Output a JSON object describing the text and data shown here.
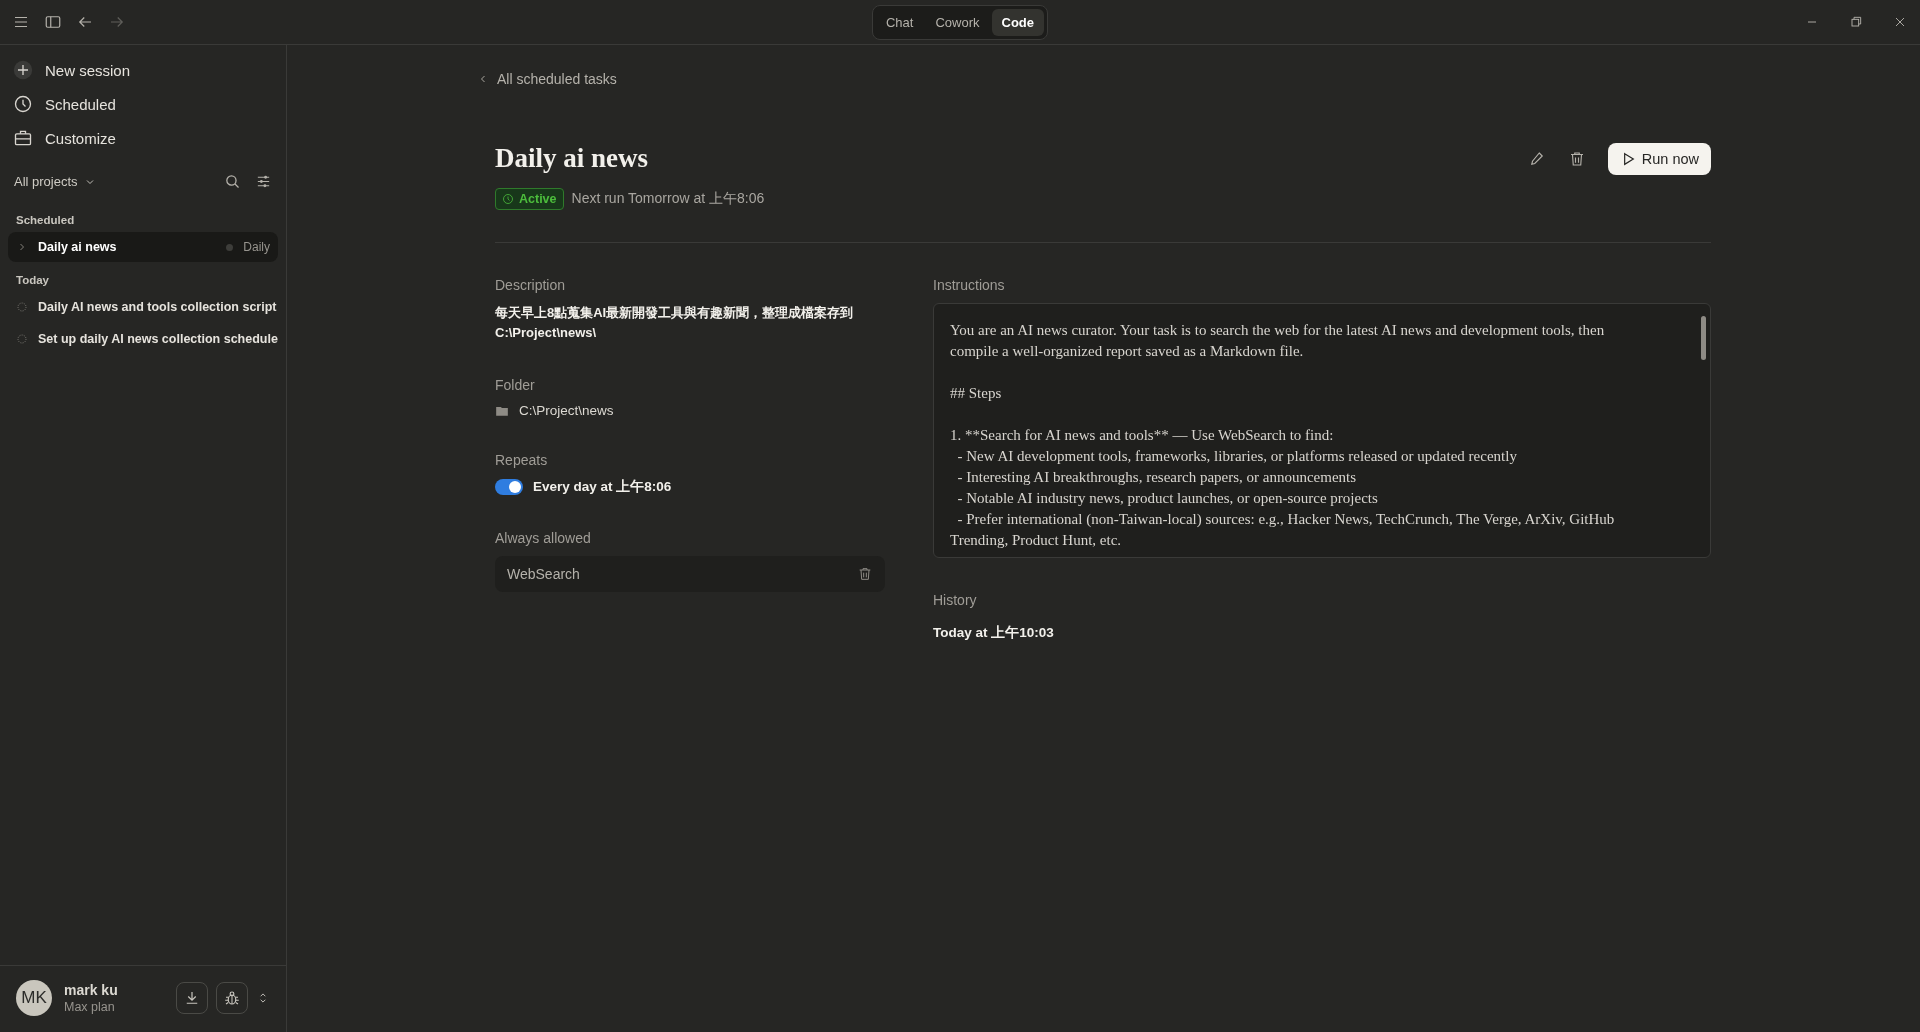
{
  "titlebar": {
    "nav": [
      {
        "kind": "menu",
        "disabled": false
      },
      {
        "kind": "sidebar",
        "disabled": false
      },
      {
        "kind": "back",
        "disabled": false
      },
      {
        "kind": "forward",
        "disabled": true
      }
    ],
    "modes": [
      {
        "label": "Chat",
        "selected": false
      },
      {
        "label": "Cowork",
        "selected": false
      },
      {
        "label": "Code",
        "selected": true
      }
    ],
    "window_controls": [
      {
        "kind": "minimize"
      },
      {
        "kind": "restore"
      },
      {
        "kind": "close"
      }
    ]
  },
  "sidebar": {
    "actions": [
      {
        "kind": "plus",
        "label": "New session"
      },
      {
        "kind": "clock",
        "label": "Scheduled"
      },
      {
        "kind": "briefcase",
        "label": "Customize"
      }
    ],
    "project_filter": "All projects",
    "sections": [
      {
        "title": "Scheduled",
        "items": [
          {
            "kind": "scheduled",
            "label": "Daily ai news",
            "badge": "Daily",
            "selected": true
          }
        ]
      },
      {
        "title": "Today",
        "items": [
          {
            "kind": "session",
            "label": "Daily AI news and tools collection script",
            "selected": false
          },
          {
            "kind": "session",
            "label": "Set up daily AI news collection schedule",
            "selected": false
          }
        ]
      }
    ],
    "user": {
      "initials": "MK",
      "name": "mark ku",
      "plan": "Max plan"
    }
  },
  "main": {
    "back_link": "All scheduled tasks",
    "title": "Daily ai news",
    "status": {
      "kind": "active",
      "label": "Active"
    },
    "next_run": "Next run Tomorrow at 上午8:06",
    "run_button": "Run now",
    "description": {
      "label": "Description",
      "text": "每天早上8點蒐集AI最新開發工具與有趣新聞，整理成檔案存到 C:\\Project\\news\\"
    },
    "folder": {
      "label": "Folder",
      "path": "C:\\Project\\news"
    },
    "repeats": {
      "label": "Repeats",
      "enabled": true,
      "text": "Every day at 上午8:06"
    },
    "always_allowed": {
      "label": "Always allowed",
      "tools": [
        "WebSearch"
      ]
    },
    "instructions": {
      "label": "Instructions",
      "paragraphs": [
        [
          "You are an AI news curator. Your task is to search the web for the latest AI news and development tools, then compile a well-organized report saved as a Markdown file."
        ],
        [
          "## Steps"
        ],
        [
          "1. **Search for AI news and tools** — Use WebSearch to find:",
          "  - New AI development tools, frameworks, libraries, or platforms released or updated recently",
          "  - Interesting AI breakthroughs, research papers, or announcements",
          "  - Notable AI industry news, product launches, or open-source projects",
          "  - Prefer international (non-Taiwan-local) sources: e.g., Hacker News, TechCrunch, The Verge, ArXiv, GitHub Trending, Product Hunt, etc."
        ]
      ]
    },
    "history": {
      "label": "History",
      "entries": [
        "Today at 上午10:03"
      ]
    }
  }
}
